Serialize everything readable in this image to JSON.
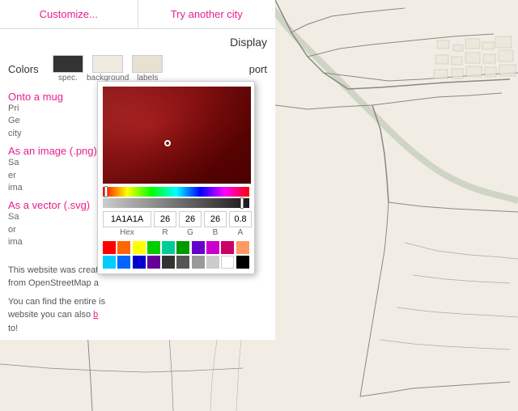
{
  "nav": {
    "tab1": "Customize...",
    "tab2": "Try another city"
  },
  "display": {
    "header": "Display",
    "colors_label": "Colors",
    "swatches": [
      {
        "id": "spec",
        "label": "spec.",
        "color": "#333333"
      },
      {
        "id": "background",
        "label": "background",
        "color": "#f0ebe0"
      },
      {
        "id": "labels",
        "label": "labels",
        "color": "#e8e0d0"
      }
    ]
  },
  "export": {
    "label": "port",
    "links": [
      {
        "title": "Onto a mug",
        "desc": "Pri\nGe\ncity"
      },
      {
        "title": "As an image (.png)",
        "desc": "Sa\ner\nima"
      },
      {
        "title": "As a vector (.svg)",
        "desc": "Sa\nor\nima"
      }
    ]
  },
  "about": {
    "text1": "This website was create",
    "text2": "from OpenStreetMap a",
    "text3": "You can find the entire",
    "text4": "website you can also b",
    "text5": "to!"
  },
  "color_picker": {
    "hex_value": "1A1A1A",
    "r": "26",
    "g": "26",
    "b": "26",
    "a": "0.8",
    "hex_label": "Hex",
    "r_label": "R",
    "g_label": "G",
    "b_label": "B",
    "a_label": "A",
    "presets": [
      "#ff0000",
      "#ff6600",
      "#ffff00",
      "#00ff00",
      "#00ffff",
      "#0000ff",
      "#9900ff",
      "#ff00ff",
      "#ff6699",
      "#ff9966",
      "#00cc44",
      "#00cccc",
      "#0066ff",
      "#6600cc",
      "#cc00cc",
      "#cc0066",
      "#009900",
      "#009999",
      "#0000cc",
      "#660099",
      "#333333",
      "#666666",
      "#999999",
      "#cccccc",
      "#ffffff",
      "#000000",
      "#ffcccc",
      "#ccffcc",
      "#ccccff",
      "#ffffcc"
    ]
  },
  "map": {
    "background_color": "#f2ede4"
  }
}
